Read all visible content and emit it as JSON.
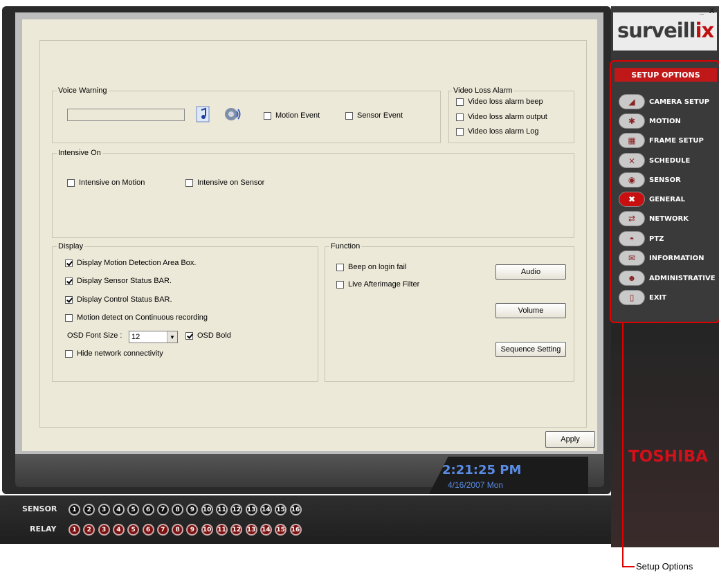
{
  "window": {
    "minimize": "_",
    "close": "X"
  },
  "brand": {
    "logo_main": "surveill",
    "logo_end": "ix",
    "toshiba": "TOSHIBA"
  },
  "voice_warning": {
    "legend": "Voice Warning",
    "motion_event": "Motion Event",
    "sensor_event": "Sensor Event"
  },
  "video_loss": {
    "legend": "Video Loss Alarm",
    "items": [
      "Video loss alarm beep",
      "Video loss alarm output",
      "Video loss alarm Log"
    ]
  },
  "intensive": {
    "legend": "Intensive On",
    "motion": "Intensive on Motion",
    "sensor": "Intensive on Sensor"
  },
  "display": {
    "legend": "Display",
    "items": [
      "Display Motion Detection Area Box.",
      "Display Sensor Status BAR.",
      "Display Control Status BAR.",
      "Motion detect on Continuous recording"
    ],
    "osd_font_label": "OSD Font Size :",
    "osd_font_value": "12",
    "osd_bold": "OSD Bold",
    "hide_network": "Hide network connectivity"
  },
  "function": {
    "legend": "Function",
    "beep": "Beep on login fail",
    "afterimage": "Live Afterimage Filter",
    "audio_btn": "Audio",
    "volume_btn": "Volume",
    "sequence_btn": "Sequence Setting"
  },
  "apply_btn": "Apply",
  "status": {
    "time": "2:21:25 PM",
    "date": "4/16/2007 Mon"
  },
  "io": {
    "sensor_label": "SENSOR",
    "relay_label": "RELAY",
    "numbers": [
      "1",
      "2",
      "3",
      "4",
      "5",
      "6",
      "7",
      "8",
      "9",
      "10",
      "11",
      "12",
      "13",
      "14",
      "15",
      "16"
    ]
  },
  "setup": {
    "title": "SETUP OPTIONS",
    "items": [
      "CAMERA SETUP",
      "MOTION",
      "FRAME SETUP",
      "SCHEDULE",
      "SENSOR",
      "GENERAL",
      "NETWORK",
      "PTZ",
      "INFORMATION",
      "ADMINISTRATIVE",
      "EXIT"
    ],
    "active": "GENERAL"
  },
  "callout": "Setup Options",
  "colors": {
    "accent_red": "#c01818",
    "clock_blue": "#5a8ce6"
  }
}
